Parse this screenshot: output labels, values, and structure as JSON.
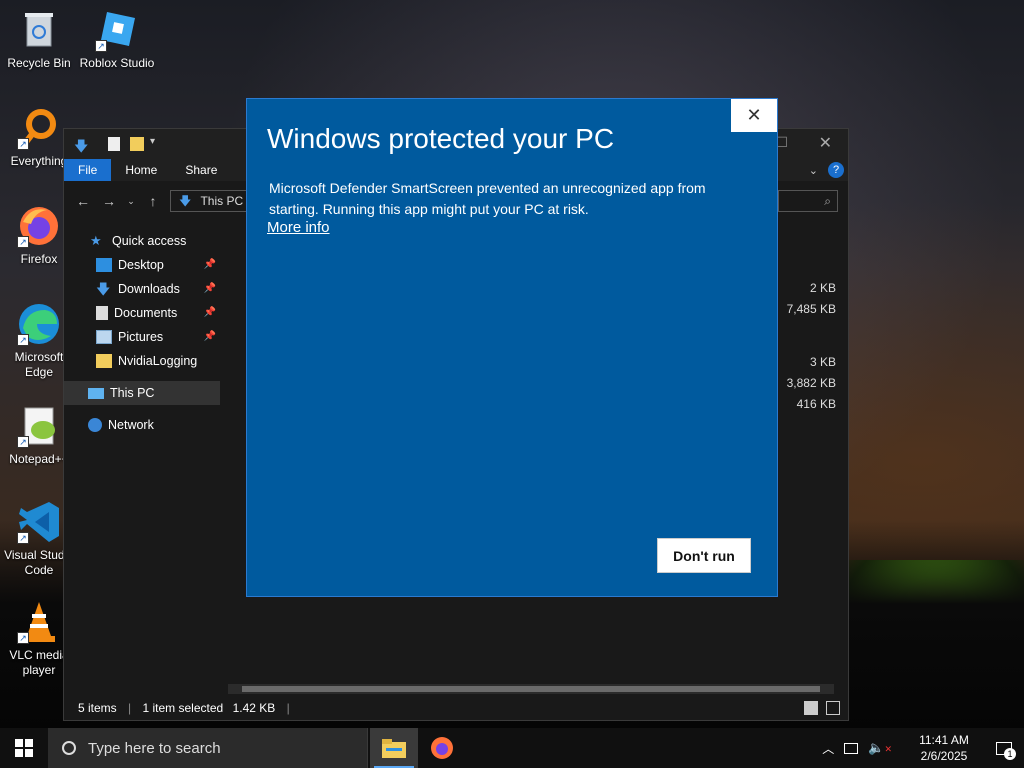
{
  "desktop": {
    "icons": [
      {
        "label": "Recycle Bin"
      },
      {
        "label": "Roblox Studio"
      },
      {
        "label": "Everything"
      },
      {
        "label": "Firefox"
      },
      {
        "label": "Microsoft Edge"
      },
      {
        "label": "Notepad++"
      },
      {
        "label": "Visual Studio Code"
      },
      {
        "label": "VLC media player"
      }
    ]
  },
  "explorer": {
    "ribbon_tabs": [
      "File",
      "Home",
      "Share"
    ],
    "address": "This PC",
    "sidebar": [
      {
        "label": "Quick access"
      },
      {
        "label": "Desktop"
      },
      {
        "label": "Downloads"
      },
      {
        "label": "Documents"
      },
      {
        "label": "Pictures"
      },
      {
        "label": "NvidiaLogging"
      },
      {
        "label": "This PC"
      },
      {
        "label": "Network"
      }
    ],
    "sizes": [
      "2 KB",
      "7,485 KB",
      "3 KB",
      "3,882 KB",
      "416 KB"
    ],
    "status": {
      "items": "5 items",
      "selected": "1 item selected",
      "size": "1.42 KB"
    }
  },
  "dialog": {
    "title": "Windows protected your PC",
    "body": "Microsoft Defender SmartScreen prevented an unrecognized app from starting. Running this app might put your PC at risk.",
    "more_info": "More info",
    "dont_run": "Don't run",
    "close_glyph": "✕"
  },
  "taskbar": {
    "search_placeholder": "Type here to search",
    "time": "11:41 AM",
    "date": "2/6/2025",
    "notification_count": "1"
  },
  "colors": {
    "dialog_bg": "#005a9e",
    "accent": "#1a6fce"
  }
}
